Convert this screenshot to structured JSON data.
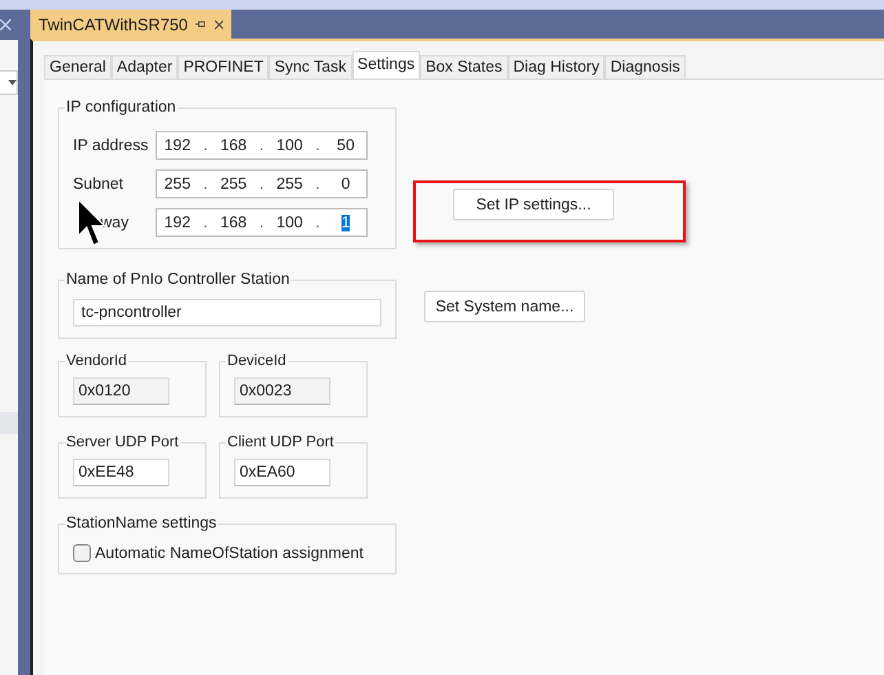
{
  "document_tab": {
    "title": "TwinCATWithSR750"
  },
  "tabs": [
    {
      "label": "General",
      "selected": false
    },
    {
      "label": "Adapter",
      "selected": false
    },
    {
      "label": "PROFINET",
      "selected": false
    },
    {
      "label": "Sync Task",
      "selected": false
    },
    {
      "label": "Settings",
      "selected": true
    },
    {
      "label": "Box States",
      "selected": false
    },
    {
      "label": "Diag History",
      "selected": false
    },
    {
      "label": "Diagnosis",
      "selected": false
    }
  ],
  "ip_configuration": {
    "title": "IP configuration",
    "octet_separator": ".",
    "fields": [
      {
        "label": "IP address",
        "covered": false,
        "octets": [
          {
            "value": "192",
            "selected": false
          },
          {
            "value": "168",
            "selected": false
          },
          {
            "value": "100",
            "selected": false
          },
          {
            "value": "50",
            "selected": false
          }
        ]
      },
      {
        "label": "Subnet",
        "covered": false,
        "octets": [
          {
            "value": "255",
            "selected": false
          },
          {
            "value": "255",
            "selected": false
          },
          {
            "value": "255",
            "selected": false
          },
          {
            "value": "0",
            "selected": false
          }
        ]
      },
      {
        "label": "way",
        "covered": true,
        "octets": [
          {
            "value": "192",
            "selected": false
          },
          {
            "value": "168",
            "selected": false
          },
          {
            "value": "100",
            "selected": false
          },
          {
            "value": "1",
            "selected": true
          }
        ]
      }
    ]
  },
  "set_ip_button": {
    "label": "Set IP settings...",
    "highlighted": true
  },
  "station_name": {
    "title": "Name of PnIo Controller Station",
    "value": "tc-pncontroller"
  },
  "set_name_button": {
    "label": "Set System name...",
    "highlighted": false
  },
  "id_groups": [
    {
      "title": "VendorId",
      "value": "0x0120",
      "editable": false
    },
    {
      "title": "DeviceId",
      "value": "0x0023",
      "editable": false
    }
  ],
  "port_groups": [
    {
      "title": "Server UDP Port",
      "value": "0xEE48",
      "editable": true
    },
    {
      "title": "Client UDP Port",
      "value": "0xEA60",
      "editable": true
    }
  ],
  "station_name_settings": {
    "title": "StationName settings",
    "checkbox": {
      "label": "Automatic NameOfStation assignment",
      "checked": false
    }
  }
}
